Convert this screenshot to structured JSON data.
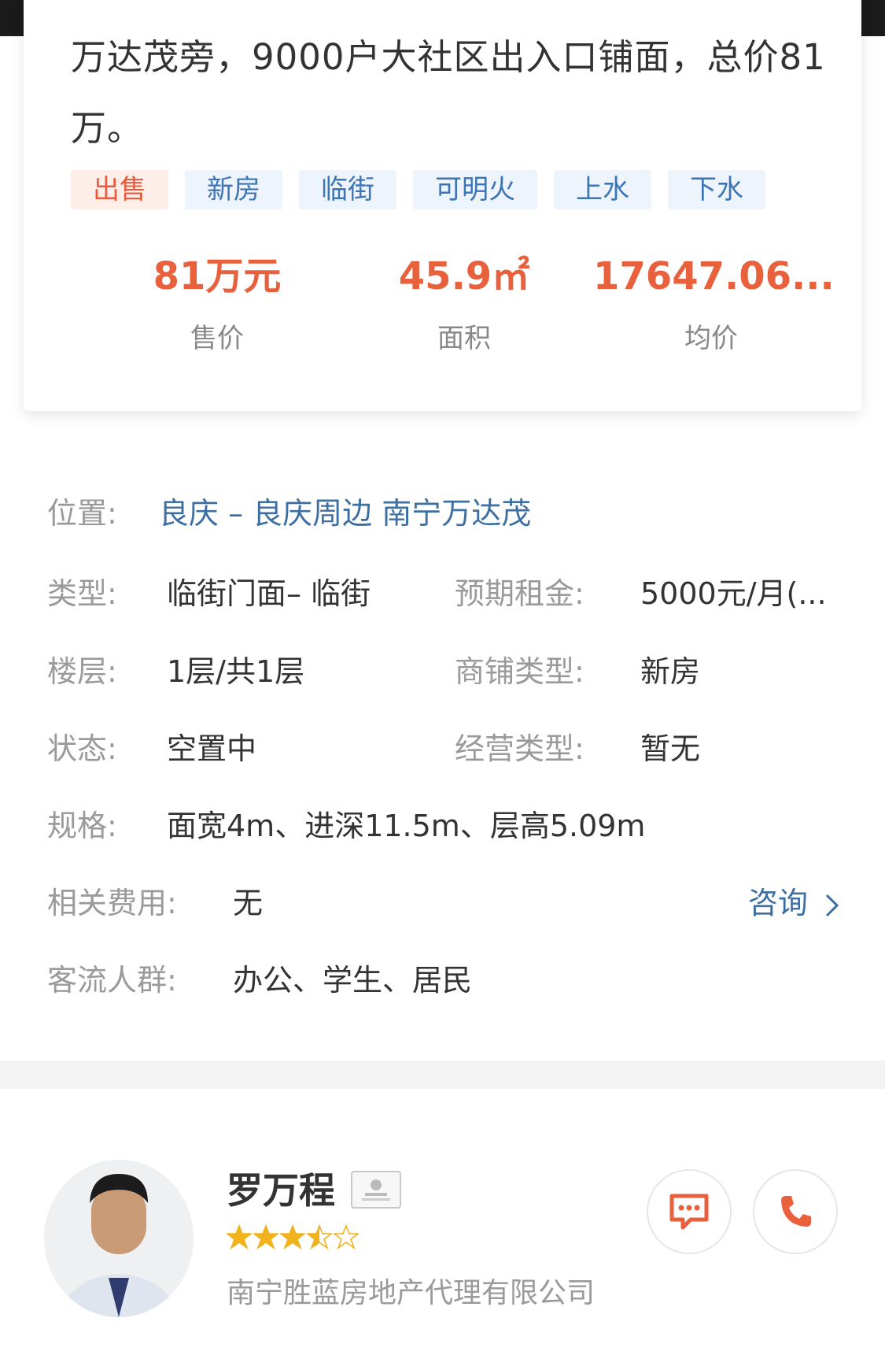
{
  "listing": {
    "title": "万达茂旁，9000户大社区出入口铺面，总价81万。",
    "tags": [
      "出售",
      "新房",
      "临街",
      "可明火",
      "上水",
      "下水"
    ],
    "stats": [
      {
        "value": "81万元",
        "label": "售价"
      },
      {
        "value": "45.9",
        "unit": "㎡",
        "label": "面积"
      },
      {
        "value": "17647.06...",
        "label": "均价"
      }
    ]
  },
  "details": {
    "location_label": "位置:",
    "location_value": "良庆 – 良庆周边 南宁万达茂",
    "type_label": "类型:",
    "type_value": "临街门面– 临街",
    "rent_label": "预期租金:",
    "rent_value": "5000元/月(...",
    "floor_label": "楼层:",
    "floor_value": "1层/共1层",
    "shop_type_label": "商铺类型:",
    "shop_type_value": "新房",
    "status_label": "状态:",
    "status_value": "空置中",
    "business_label": "经营类型:",
    "business_value": "暂无",
    "spec_label": "规格:",
    "spec_value": "面宽4m、进深11.5m、层高5.09m",
    "fees_label": "相关费用:",
    "fees_value": "无",
    "consult_label": "咨询",
    "crowd_label": "客流人群:",
    "crowd_value": "办公、学生、居民"
  },
  "agent": {
    "name": "罗万程",
    "rating": 3.5,
    "company": "南宁胜蓝房地产代理有限公司"
  },
  "colors": {
    "accent": "#e8603c",
    "link": "#3d6fa3",
    "tag_blue_bg": "#eef4fb",
    "tag_red_bg": "#fdeeea"
  }
}
